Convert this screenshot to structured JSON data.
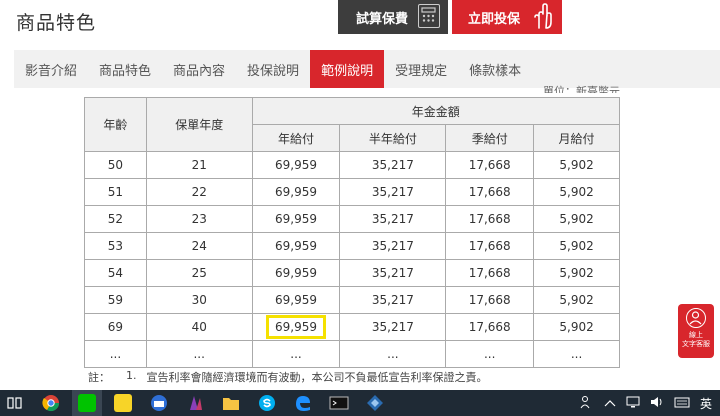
{
  "header": {
    "title": "商品特色",
    "calc_button": "試算保費",
    "apply_button": "立即投保"
  },
  "tabs": [
    {
      "label": "影音介紹",
      "active": false
    },
    {
      "label": "商品特色",
      "active": false
    },
    {
      "label": "商品內容",
      "active": false
    },
    {
      "label": "投保說明",
      "active": false
    },
    {
      "label": "範例說明",
      "active": true
    },
    {
      "label": "受理規定",
      "active": false
    },
    {
      "label": "條款樣本",
      "active": false
    }
  ],
  "unit_text": "單位：新臺幣元",
  "table": {
    "h_age": "年齡",
    "h_year": "保單年度",
    "h_group": "年金金額",
    "h_sub": [
      "年給付",
      "半年給付",
      "季給付",
      "月給付"
    ],
    "rows": [
      [
        "50",
        "21",
        "69,959",
        "35,217",
        "17,668",
        "5,902"
      ],
      [
        "51",
        "22",
        "69,959",
        "35,217",
        "17,668",
        "5,902"
      ],
      [
        "52",
        "23",
        "69,959",
        "35,217",
        "17,668",
        "5,902"
      ],
      [
        "53",
        "24",
        "69,959",
        "35,217",
        "17,668",
        "5,902"
      ],
      [
        "54",
        "25",
        "69,959",
        "35,217",
        "17,668",
        "5,902"
      ],
      [
        "59",
        "30",
        "69,959",
        "35,217",
        "17,668",
        "5,902"
      ],
      [
        "69",
        "40",
        "69,959",
        "35,217",
        "17,668",
        "5,902"
      ],
      [
        "...",
        "...",
        "...",
        "...",
        "...",
        "..."
      ]
    ],
    "highlight_row": 6,
    "highlight_col": 2,
    "highlight_color": "#f5e100"
  },
  "note": {
    "label": "註：",
    "num": "1.",
    "text": "宣告利率會隨經濟環境而有波動，本公司不負最低宣告利率保證之責。"
  },
  "cs_widget": {
    "line1": "線上",
    "line2": "文字客服"
  },
  "colors": {
    "accent": "#d8262c",
    "dark_button": "#3d3d3d",
    "tab_bg": "#f1f1f1",
    "taskbar": "#1f2a35"
  },
  "taskbar": {
    "icons": [
      "task-view-icon",
      "chrome-icon",
      "line-icon",
      "sticky-notes-icon",
      "browser-icon",
      "paint-icon",
      "file-explorer-icon",
      "skype-icon",
      "edge-icon",
      "terminal-icon",
      "app-icon"
    ],
    "lang": "英"
  }
}
